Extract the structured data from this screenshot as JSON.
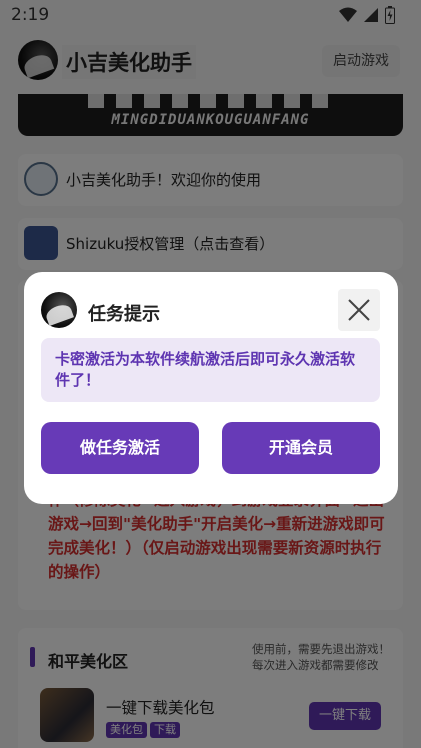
{
  "status_bar": {
    "time": "2:19",
    "icons": [
      "wifi-icon",
      "signal-icon",
      "battery-icon"
    ]
  },
  "header": {
    "title": "小吉美化助手",
    "launch_button": "启动游戏"
  },
  "banner": {
    "text": "MINGDIDUANKOUGUANFANG"
  },
  "list": {
    "welcome": "小吉美化助手！欢迎你的使用",
    "shizuku": "Shizuku授权管理（点击查看）"
  },
  "guide": {
    "text": "作（修除美化→进入游戏，到游戏登录界面→退出游戏→回到\"美化助手\"开启美化→重新进游戏即可完成美化！）（仅启动游戏出现需要新资源时执行的操作）"
  },
  "zone": {
    "title": "和平美化区",
    "notice_line1": "使用前，需要先退出游戏！",
    "notice_line2": "每次进入游戏都需要修改",
    "package": {
      "title": "一键下载美化包",
      "tags": [
        "美化包",
        "下载"
      ],
      "button": "一键下载"
    }
  },
  "dialog": {
    "title": "任务提示",
    "message": "卡密激活为本软件续航激活后即可永久激活软件了！",
    "btn_task": "做任务激活",
    "btn_vip": "开通会员"
  },
  "colors": {
    "accent": "#673ab7",
    "accent_light": "#ede7f6",
    "warning_text": "#d32f2f"
  }
}
